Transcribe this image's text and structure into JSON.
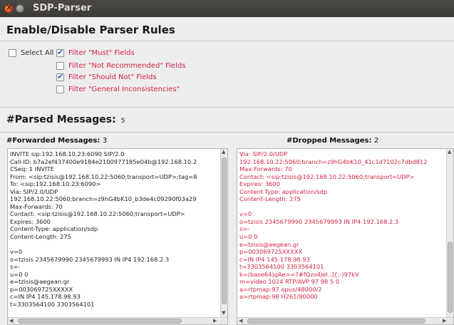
{
  "window": {
    "title": "SDP-Parser"
  },
  "rules": {
    "heading": "Enable/Disable Parser Rules",
    "select_all": "Select All",
    "filters": [
      {
        "label": "Filter \"Must\" Fields",
        "checked": true
      },
      {
        "label": "Filter \"Not Recommended\" Fields",
        "checked": false
      },
      {
        "label": "Filter \"Should Not\" Fields",
        "checked": true
      },
      {
        "label": "Filter \"General Inconsistencies\"",
        "checked": false
      }
    ]
  },
  "parsed": {
    "heading": "#Parsed Messages:",
    "count": "5"
  },
  "forwarded": {
    "heading": "#Forwarded Messages:",
    "count": "3",
    "text": "INVITE sip:192.168.10.23:6090 SIP/2.0\nCall-ID: b7a2ef437400e9184e2100977185e04b@192.168.10.2\nCSeq: 1 INVITE\nFrom: <sip:tzisis@192.168.10.22:5060;transport=UDP>;tag=8\nTo: <sip:192.168.10.23:6090>\nVia: SIP/2.0/UDP\n192.168.10.22:5060;branch=z9hG4bK10_b3de4c09290f03a29\nMax-Forwards: 70\nContact: <sip:tzisis@192.168.10.22:5060;transport=UDP>\nExpires: 3600\nContent-Type: application/sdp\nContent-Length: 275\n\nv=0\no=tzisis 2345679990 2345679993 IN IP4 192.168.2.3\ns=-\nu=0 0\ne=tzisis@aegean.gr\np=003069725XXXXX\nc=IN IP4 145.178.98.93\nt=3303564100 3303564101"
  },
  "dropped": {
    "heading": "#Dropped Messages:",
    "count": "2",
    "text": "Via: SIP/2.0/UDP\n192.168.10.22:5060;branch=z9hG4bK10_41c1d7102c7dbd812\nMax-Forwards: 70\nContact: <sip:tzisis@192.168.10.22:5060;transport=UDP>\nExpires: 3600\nContent-Type: application/sdp\nContent-Length: 275\n\nv=0\no=tzisis 2345679990 2345679993 IN IP4 192.168.2.3\ns=-\nu=0 0\ne=tzisis@aegean.gr\np=003069725XXXXX\nc=IN IP4 145.178.98.93\nt=3303564100 3303564101\nk=(base64)gAe>=?#fQzo4jel.:]{:-)97kV\nm=video 1024 RTP/AVP 97 98 5 0\na=rtpmap:97 opus/48000/2\na=rtpmap:98 H261/90000"
  },
  "colors": {
    "accent_red": "#d2244a",
    "titlebar": "#3b3a36"
  }
}
